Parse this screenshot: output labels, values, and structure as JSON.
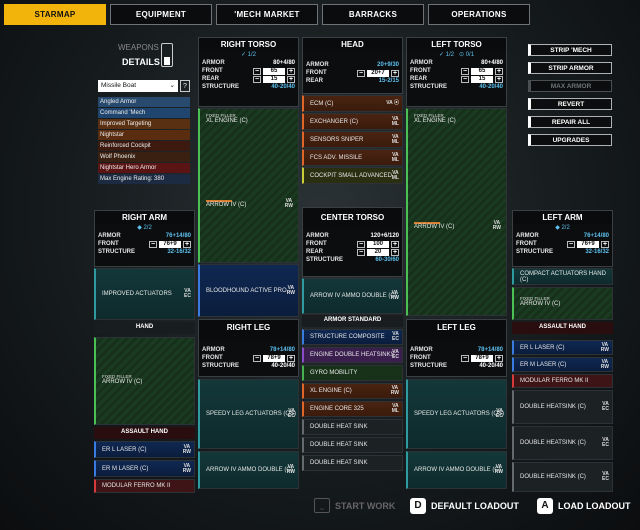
{
  "tabs": [
    "STARMAP",
    "EQUIPMENT",
    "'MECH MARKET",
    "BARRACKS",
    "OPERATIONS"
  ],
  "weapons_toggle": {
    "label1": "WEAPONS",
    "label2": "DETAILS"
  },
  "mech_select": {
    "value": "Missile Boat",
    "help": "?"
  },
  "filters": [
    "Angled Armor",
    "Command 'Mech",
    "Improved Targeting",
    "Nightstar",
    "Reinforced Cockpit",
    "Wolf Phoenix",
    "Nightstar Hero Armor",
    "Max Engine Rating: 380"
  ],
  "right_torso": {
    "title": "RIGHT TORSO",
    "heat": "1/2",
    "armor": "80+4/80",
    "front": "65",
    "rear": "15",
    "structure": "40-20/40",
    "items": [
      "FIXED FILLER",
      "XL ENGINE (C)",
      "ARROW IV (C)",
      "BLOODHOUND ACTIVE PRO..."
    ]
  },
  "head": {
    "title": "HEAD",
    "armor": "20+9/30",
    "front": "20+7",
    "rear": "15-2/15",
    "items": [
      "ECM (C)",
      "EXCHANGER (C)",
      "SENSORS SNIPER",
      "FCS ADV. MISSILE",
      "COCKPIT SMALL ADVANCED"
    ]
  },
  "left_torso": {
    "title": "LEFT TORSO",
    "heat1": "1/2",
    "heat2": "0/1",
    "armor": "80+4/80",
    "front": "65",
    "rear": "15",
    "structure": "40-20/40",
    "items": [
      "FIXED FILLER",
      "XL ENGINE (C)",
      "ARROW IV (C)"
    ]
  },
  "center_torso": {
    "title": "CENTER TORSO",
    "armor": "120+6/120",
    "front": "100",
    "rear": "20",
    "structure": "60-30/60",
    "items": [
      "ARROW IV AMMO DOUBLE (C)"
    ]
  },
  "armor_standard": {
    "title": "ARMOR STANDARD",
    "items": [
      "STRUCTURE COMPOSITE",
      "ENGINE DOUBLE HEATSINKS",
      "GYRO MOBILITY",
      "XL ENGINE (C)",
      "ENGINE CORE 325",
      "DOUBLE HEAT SINK",
      "DOUBLE HEAT SINK",
      "DOUBLE HEAT SINK"
    ]
  },
  "right_arm": {
    "title": "RIGHT ARM",
    "heat": "2/2",
    "armor": "76+14/80",
    "front": "76+9",
    "structure": "32-16/32",
    "items": [
      "IMPROVED ACTUATORS"
    ],
    "hand": "HAND",
    "hand_items": [
      "FIXED FILLER",
      "ARROW IV (C)"
    ],
    "assault": "ASSAULT HAND",
    "assault_items": [
      "ER L LASER (C)",
      "ER M LASER (C)",
      "MODULAR FERRO MK II"
    ]
  },
  "right_leg": {
    "title": "RIGHT LEG",
    "armor": "78+14/80",
    "front": "78+9",
    "structure": "40-20/40",
    "items": [
      "SPEEDY LEG ACTUATORS (QS)",
      "ARROW IV AMMO DOUBLE (C)"
    ]
  },
  "left_leg": {
    "title": "LEFT LEG",
    "armor": "78+14/80",
    "front": "78+9",
    "structure": "40-20/40",
    "items": [
      "SPEEDY LEG ACTUATORS (QS)",
      "ARROW IV AMMO DOUBLE (C)"
    ]
  },
  "left_arm": {
    "title": "LEFT ARM",
    "heat": "2/2",
    "armor": "76+14/80",
    "front": "76+9",
    "structure": "32-16/32",
    "items": [
      "COMPACT ACTUATORS HAND (C)",
      "FIXED FILLER",
      "ARROW IV (C)"
    ],
    "assault": "ASSAULT HAND",
    "assault_items": [
      "ER L LASER (C)",
      "ER M LASER (C)",
      "MODULAR FERRO MK II",
      "DOUBLE HEATSINK (C)",
      "DOUBLE HEATSINK (C)",
      "DOUBLE HEATSINK (C)"
    ]
  },
  "labels": {
    "armor": "ARMOR",
    "front": "FRONT",
    "rear": "REAR",
    "structure": "STRUCTURE",
    "va": "VA",
    "rw": "RW",
    "ec": "EC",
    "ml": "ML"
  },
  "right_buttons": [
    "STRIP 'MECH",
    "STRIP ARMOR",
    "MAX ARMOR",
    "REVERT",
    "REPAIR ALL",
    "UPGRADES"
  ],
  "bottom": {
    "start_work": "START WORK",
    "default_key": "D",
    "default": "DEFAULT LOADOUT",
    "load_key": "A",
    "load": "LOAD LOADOUT"
  }
}
